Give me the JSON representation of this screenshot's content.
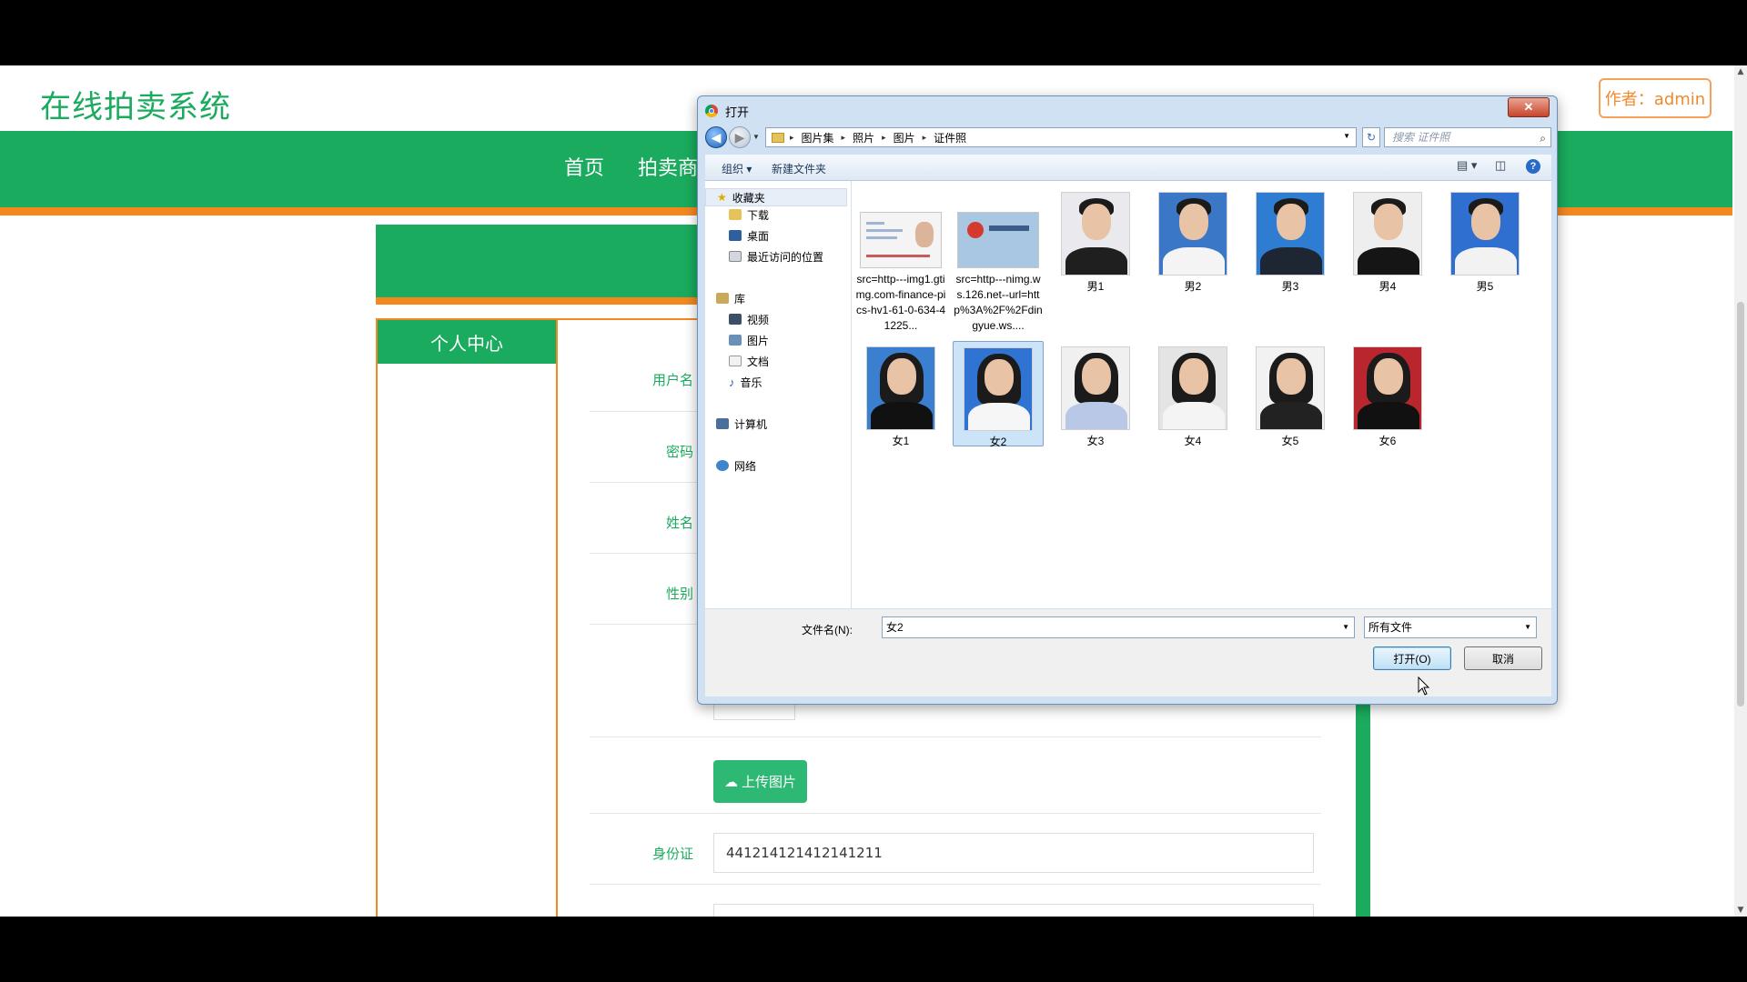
{
  "site": {
    "title": "在线拍卖系统",
    "author": "作者：admin",
    "nav": [
      "首页",
      "拍卖商"
    ],
    "sidebar_title": "个人中心"
  },
  "form": {
    "labels": [
      "用户名",
      "密码",
      "姓名",
      "性别"
    ],
    "upload_button": "上传图片",
    "idcard_label": "身份证",
    "idcard_value": "441214121412141211"
  },
  "dialog": {
    "title": "打开",
    "breadcrumb": [
      "图片集",
      "照片",
      "图片",
      "证件照"
    ],
    "search_placeholder": "搜索 证件照",
    "toolbar": {
      "organize": "组织",
      "new_folder": "新建文件夹"
    },
    "tree": {
      "favorites": "收藏夹",
      "downloads": "下载",
      "desktop": "桌面",
      "recent": "最近访问的位置",
      "libraries": "库",
      "videos": "视频",
      "pictures": "图片",
      "documents": "文档",
      "music": "音乐",
      "computer": "计算机",
      "network": "网络"
    },
    "files_row1": [
      {
        "label": "src=http---img1.gtimg.com-finance-pics-hv1-61-0-634-41225...",
        "kind": "doc"
      },
      {
        "label": "src=http---nimg.ws.126.net--url=http%3A%2F%2Fdingyue.ws....",
        "kind": "idcard"
      },
      {
        "label": "男1",
        "kind": "male"
      },
      {
        "label": "男2",
        "kind": "male"
      },
      {
        "label": "男3",
        "kind": "male"
      },
      {
        "label": "男4",
        "kind": "male"
      },
      {
        "label": "男5",
        "kind": "male"
      }
    ],
    "files_row2": [
      {
        "label": "女1",
        "kind": "female"
      },
      {
        "label": "女2",
        "kind": "female",
        "selected": true
      },
      {
        "label": "女3",
        "kind": "female"
      },
      {
        "label": "女4",
        "kind": "female"
      },
      {
        "label": "女5",
        "kind": "female"
      },
      {
        "label": "女6",
        "kind": "female"
      }
    ],
    "filename_label": "文件名(N):",
    "filename_value": "女2",
    "filetype_value": "所有文件",
    "open_button": "打开(O)",
    "cancel_button": "取消",
    "colors": {
      "selected_bg": "#cce4f7",
      "accent_green": "#1aab5e",
      "accent_orange": "#f5871f"
    }
  }
}
